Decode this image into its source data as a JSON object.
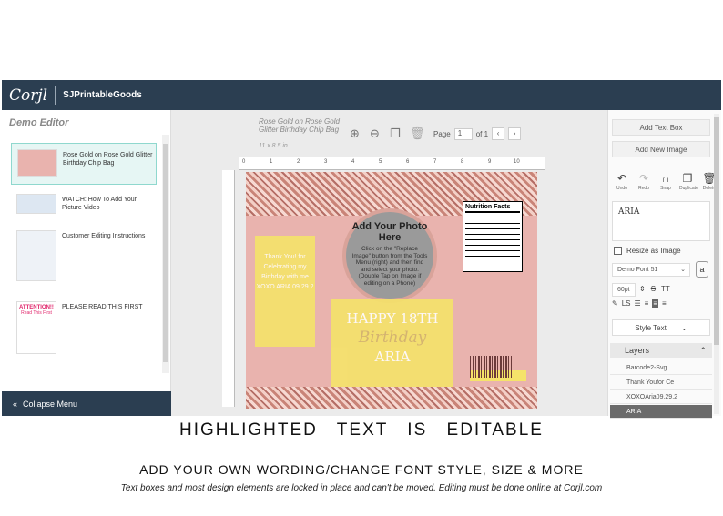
{
  "app": {
    "logo": "Corjl",
    "shop": "SJPrintableGoods"
  },
  "left_panel": {
    "title": "Demo Editor",
    "templates": [
      {
        "label": "Rose Gold on Rose Gold Glitter Birthday Chip Bag"
      },
      {
        "label": "WATCH: How To Add Your Picture Video"
      },
      {
        "label": "Customer Editing Instructions"
      },
      {
        "label": "PLEASE READ THIS FIRST"
      }
    ],
    "attention": "ATTENTION!!",
    "attention_sub": "Read This First",
    "collapse_label": "Collapse Menu"
  },
  "document": {
    "name": "Rose Gold on Rose Gold Glitter Birthday Chip Bag",
    "size": "11 x 8.5 in",
    "page_label": "Page",
    "page_current": "1",
    "page_of": "of 1",
    "ruler_ticks": [
      "0",
      "1",
      "2",
      "3",
      "4",
      "5",
      "6",
      "7",
      "8",
      "9",
      "10"
    ]
  },
  "design": {
    "photo_title": "Add Your Photo Here",
    "photo_body": "Click on the \"Replace Image\" button from the Tools Menu (right) and then find and select your photo. (Double Tap on Image if editing on a Phone)",
    "nutrition_title": "Nutrition Facts",
    "thank_text": "Thank You! for Celebrating my Birthday with me XOXO ARIA 09.29.2",
    "happy": "HAPPY 18TH",
    "birthday": "Birthday",
    "name": "ARIA"
  },
  "right_panel": {
    "add_text": "Add Text Box",
    "add_image": "Add New Image",
    "tools": [
      "Undo",
      "Redo",
      "Snap",
      "Duplicate",
      "Delete"
    ],
    "text_value": "ARIA",
    "resize_label": "Resize as Image",
    "font": "Demo Font 51",
    "size": "60pt",
    "style_text": "Style Text",
    "layers_title": "Layers",
    "layers": [
      "Barcode2-Svg",
      "Thank Youfor Ce",
      "XOXOAria09.29.2",
      "ARIA"
    ]
  },
  "captions": {
    "headline": "HIGHLIGHTED TEXT IS EDITABLE",
    "subhead": "ADD YOUR OWN WORDING/CHANGE FONT STYLE, SIZE & MORE",
    "note": "Text boxes and most design elements are locked in place and can't be moved. Editing must be done online at Corjl.com"
  }
}
